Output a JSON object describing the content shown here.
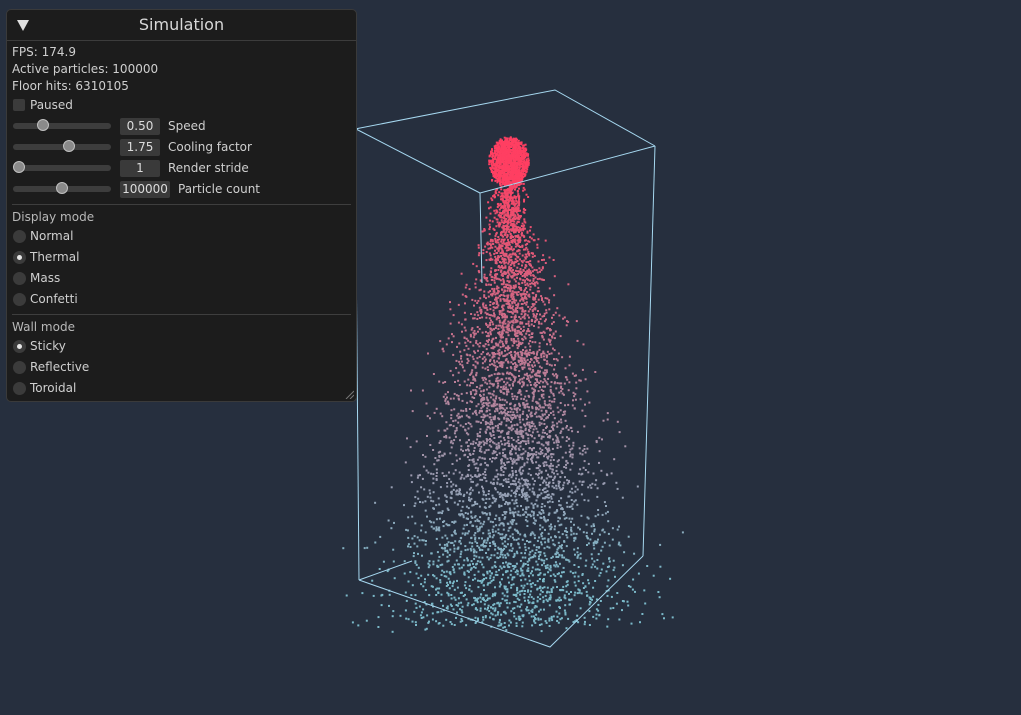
{
  "panel": {
    "title": "Simulation",
    "stats": {
      "fps": "FPS: 174.9",
      "active": "Active particles: 100000",
      "floor": "Floor hits: 6310105"
    },
    "paused": {
      "label": "Paused",
      "checked": false
    },
    "sliders": [
      {
        "label": "Speed",
        "value": "0.50",
        "fraction": 0.28
      },
      {
        "label": "Cooling factor",
        "value": "1.75",
        "fraction": 0.58
      },
      {
        "label": "Render stride",
        "value": "1",
        "fraction": 0.0
      },
      {
        "label": "Particle count",
        "value": "100000",
        "fraction": 0.5
      }
    ],
    "display_mode": {
      "title": "Display mode",
      "options": [
        "Normal",
        "Thermal",
        "Mass",
        "Confetti"
      ],
      "selected": "Thermal"
    },
    "wall_mode": {
      "title": "Wall mode",
      "options": [
        "Sticky",
        "Reflective",
        "Toroidal"
      ],
      "selected": "Sticky"
    }
  },
  "colors": {
    "background": "#262f3e",
    "box_edges": "#a6d8f0",
    "particle_hot": "#ff3f62",
    "particle_cool": "#7bb9c9"
  },
  "icons": {
    "collapse": "triangle-down-icon",
    "resize": "resize-grip-icon"
  }
}
